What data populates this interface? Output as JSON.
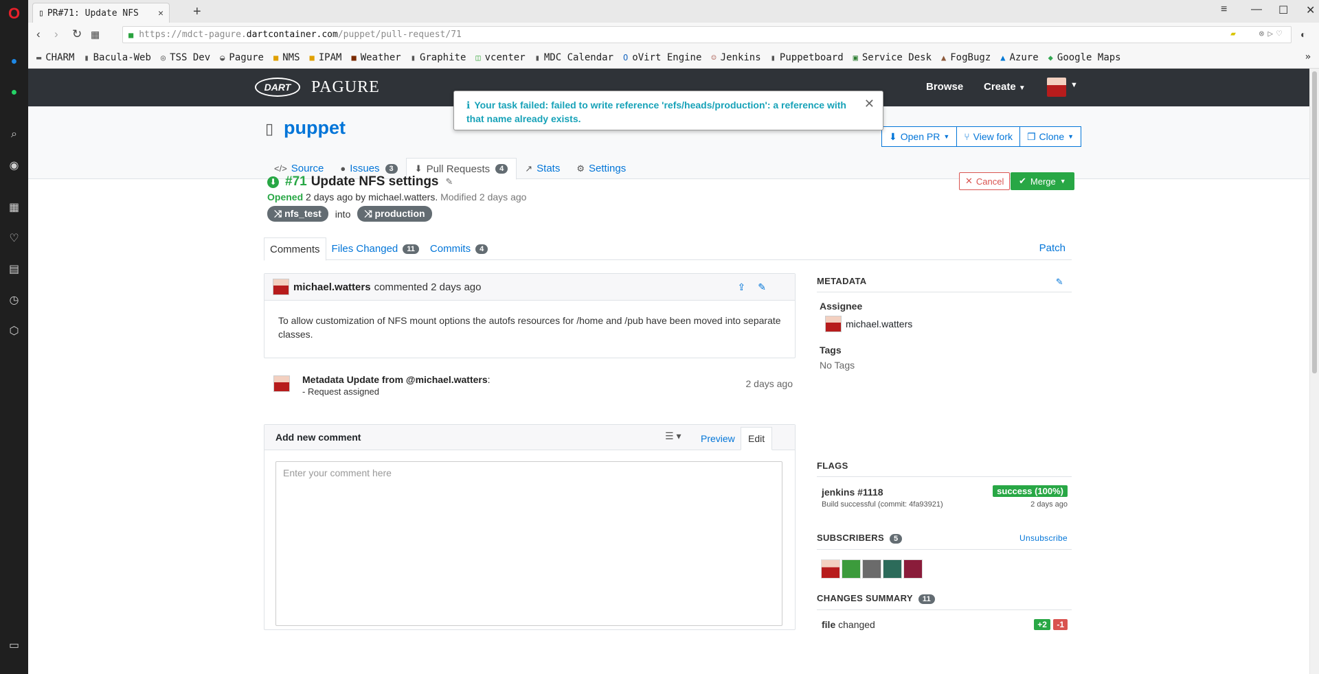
{
  "browser": {
    "tab_title": "PR#71: Update NFS",
    "url_scheme": "https://",
    "url_sub": "mdct-pagure.",
    "url_host": "dartcontainer.com",
    "url_path": "/puppet/pull-request/71"
  },
  "bookmarks": [
    {
      "label": "CHARM",
      "icon": "sap-icon"
    },
    {
      "label": "Bacula-Web",
      "icon": "page-icon"
    },
    {
      "label": "TSS Dev",
      "icon": "globe-icon"
    },
    {
      "label": "Pagure",
      "icon": "pagure-icon"
    },
    {
      "label": "NMS",
      "icon": "nms-icon"
    },
    {
      "label": "IPAM",
      "icon": "ipam-icon"
    },
    {
      "label": "Weather",
      "icon": "weather-icon"
    },
    {
      "label": "Graphite",
      "icon": "page-icon"
    },
    {
      "label": "vcenter",
      "icon": "vcenter-icon"
    },
    {
      "label": "MDC Calendar",
      "icon": "page-icon"
    },
    {
      "label": "oVirt Engine",
      "icon": "ovirt-icon"
    },
    {
      "label": "Jenkins",
      "icon": "jenkins-icon"
    },
    {
      "label": "Puppetboard",
      "icon": "page-icon"
    },
    {
      "label": "Service Desk",
      "icon": "servicedesk-icon"
    },
    {
      "label": "FogBugz",
      "icon": "fogbugz-icon"
    },
    {
      "label": "Azure",
      "icon": "azure-icon"
    },
    {
      "label": "Google Maps",
      "icon": "maps-icon"
    }
  ],
  "navbar": {
    "logo": "DART",
    "brand": "PAGURE",
    "browse": "Browse",
    "create": "Create"
  },
  "repo": {
    "name": "puppet",
    "buttons": {
      "open_pr": "Open PR",
      "view_fork": "View fork",
      "clone": "Clone"
    },
    "tabs": [
      {
        "label": "Source",
        "count": ""
      },
      {
        "label": "Issues",
        "count": "3"
      },
      {
        "label": "Pull Requests",
        "count": "4"
      },
      {
        "label": "Stats",
        "count": ""
      },
      {
        "label": "Settings",
        "count": ""
      }
    ]
  },
  "alert": {
    "message": "Your task failed: failed to write reference 'refs/heads/production': a reference with that name already exists."
  },
  "pr": {
    "number": "#71",
    "title": "Update NFS settings",
    "opened": "Opened",
    "opened_rest": "2 days ago by michael.watters.",
    "modified": "Modified 2 days ago",
    "from_branch": "nfs_test",
    "into": "into",
    "to_branch": "production",
    "cancel": "Cancel",
    "merge": "Merge"
  },
  "pr_tabs": {
    "comments": "Comments",
    "files_changed": "Files Changed",
    "files_count": "11",
    "commits": "Commits",
    "commits_count": "4",
    "patch": "Patch"
  },
  "comment": {
    "user": "michael.watters",
    "action": "commented 2 days ago",
    "body": "To allow customization of NFS mount options the autofs resources for /home and /pub have been moved into separate classes."
  },
  "metadata_update": {
    "title_prefix": "Metadata Update from",
    "user": "@michael.watters",
    "suffix": ":",
    "item": "- Request assigned",
    "when": "2 days ago"
  },
  "add_comment": {
    "title": "Add new comment",
    "preview": "Preview",
    "edit": "Edit",
    "placeholder": "Enter your comment here"
  },
  "sidebar": {
    "metadata": "METADATA",
    "assignee_label": "Assignee",
    "assignee": "michael.watters",
    "tags_label": "Tags",
    "tags_value": "No Tags",
    "flags": "FLAGS",
    "flag_name": "jenkins #1118",
    "flag_sub": "Build successful (commit: 4fa93921)",
    "flag_status": "success (100%)",
    "flag_when": "2 days ago",
    "subscribers": "SUBSCRIBERS",
    "subscribers_count": "5",
    "unsubscribe": "Unsubscribe",
    "changes_summary": "CHANGES SUMMARY",
    "changes_count": "11",
    "file_label": "file",
    "file_changed": "changed",
    "additions": "+2",
    "deletions": "-1"
  },
  "colors": {
    "navbar": "#2f3338",
    "link": "#0275d8",
    "success": "#28a745",
    "danger": "#d9534f",
    "info": "#17a2b8"
  }
}
